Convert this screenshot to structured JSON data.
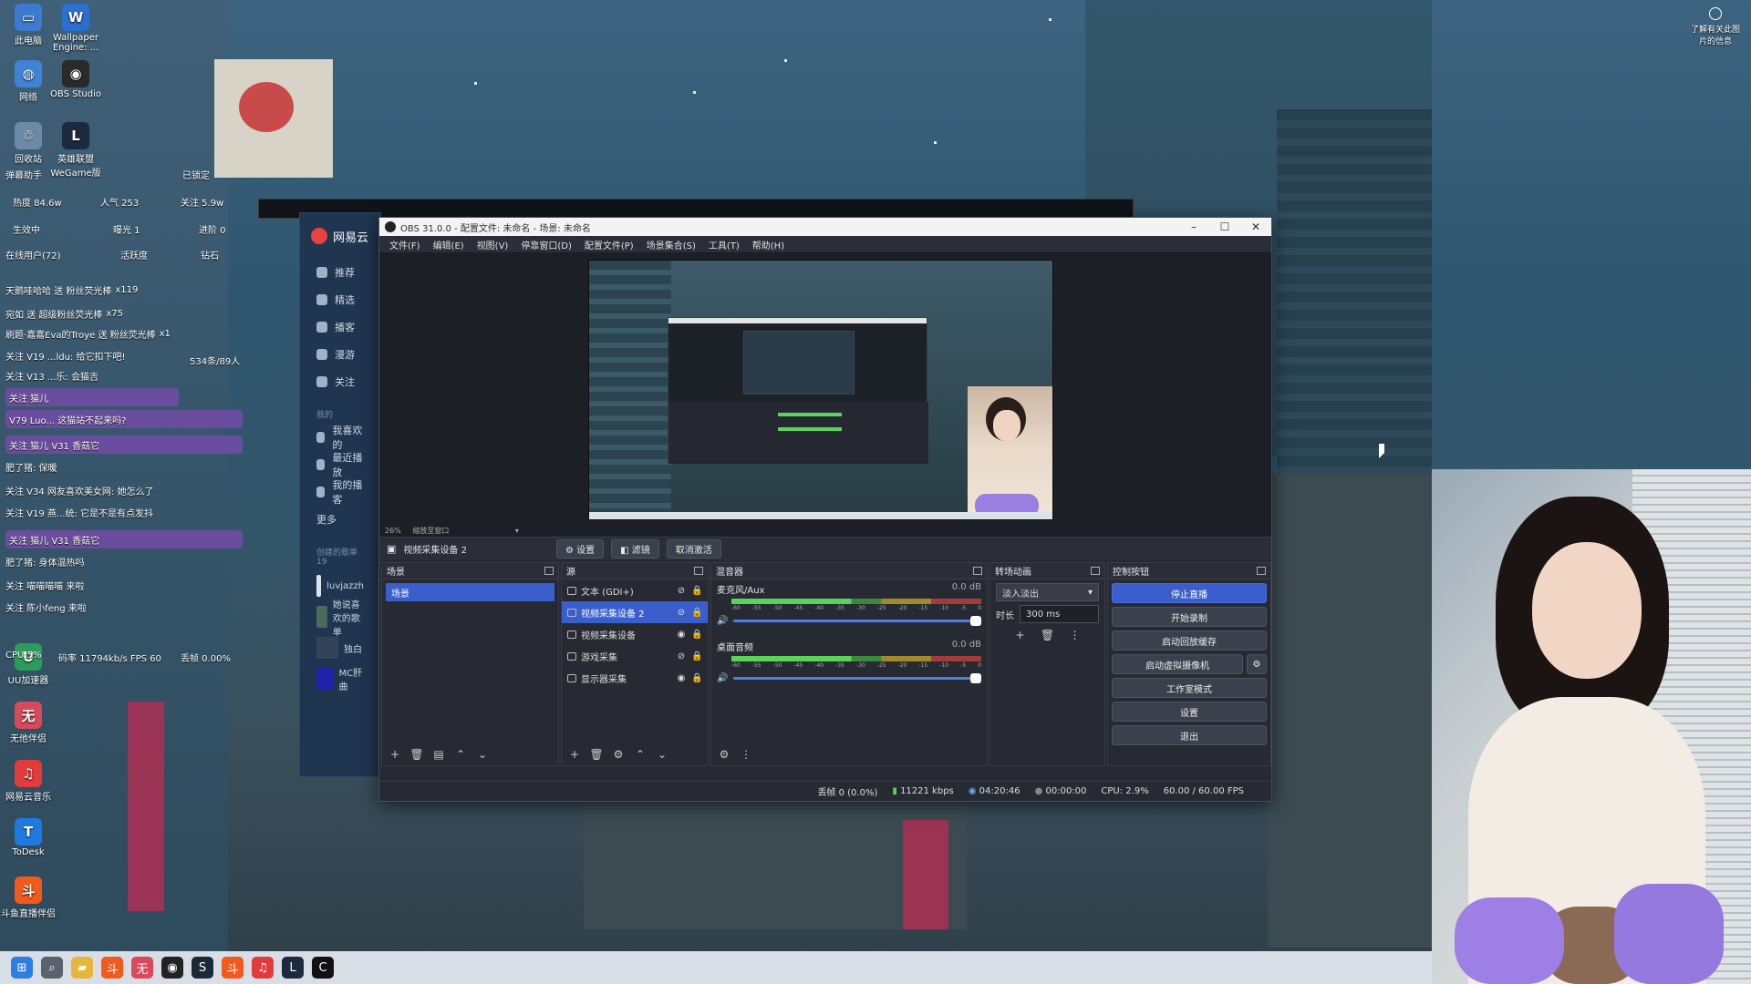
{
  "desktop": {
    "icons": [
      {
        "label": "此电脑",
        "color": "#3d7bd1",
        "glyph": "▭"
      },
      {
        "label": "Wallpaper Engine: ...",
        "color": "#2b6fcf",
        "glyph": "W"
      },
      {
        "label": "网络",
        "color": "#3f83d6",
        "glyph": "◍"
      },
      {
        "label": "OBS Studio",
        "color": "#2a2a2a",
        "glyph": "◉"
      },
      {
        "label": "回收站",
        "color": "#6c8aa8",
        "glyph": "♲"
      },
      {
        "label": "英雄联盟 WeGame版",
        "color": "#1c2a40",
        "glyph": "L"
      },
      {
        "label": "UU加速器",
        "color": "#2a9d5c",
        "glyph": "U"
      },
      {
        "label": "无他伴侣",
        "color": "#d84a5a",
        "glyph": "无"
      },
      {
        "label": "网易云音乐",
        "color": "#e23b3b",
        "glyph": "♫"
      },
      {
        "label": "ToDesk",
        "color": "#1f7ae0",
        "glyph": "T"
      },
      {
        "label": "斗鱼直播伴侣",
        "color": "#f25a1c",
        "glyph": "斗"
      }
    ],
    "hint": "了解有关此图片的信息"
  },
  "chat": {
    "title": "弹幕助手",
    "locked": "已锁定",
    "heat": "热度 84.6w",
    "people": "人气 253",
    "follow": "关注 5.9w",
    "live": "生效中",
    "exposure": "曝光 1",
    "progress": "进阶 0",
    "online": "在线用户(72)",
    "activity": "活跃度",
    "diamond": "钻石",
    "speed_label": "CPU:5%",
    "bitrate": "码率 11794kb/s FPS 60",
    "drop": "丢帧 0.00%",
    "side_count": "534条/89人",
    "lines": [
      {
        "text": "天鹅哇哈哈 送 粉丝荧光棒",
        "count": "x119",
        "hl": false
      },
      {
        "text": "宛如 送 超级粉丝荧光棒",
        "count": "x75",
        "hl": false
      },
      {
        "text": "刷题·嘉嘉Eva的Troye 送 粉丝荧光棒",
        "count": "x1",
        "hl": false
      },
      {
        "text": "关注 V19 ...ldu: 给它扣下吧!",
        "count": "",
        "hl": false
      },
      {
        "text": "关注 V13 ...乐: 会猫吉",
        "count": "",
        "hl": false
      },
      {
        "text": "关注 猫儿",
        "count": "",
        "hl": true
      },
      {
        "text": "V79 Luo... 这猫站不起来吗?",
        "count": "",
        "hl": true
      },
      {
        "text": "关注 猫儿 V31 香菇它",
        "count": "",
        "hl": true
      },
      {
        "text": "肥了猪: 保暖",
        "count": "",
        "hl": false
      },
      {
        "text": "关注 V34 网友喜欢美女网: 她怎么了",
        "count": "",
        "hl": false
      },
      {
        "text": "关注 V19 燕...统: 它是不是有点发抖",
        "count": "",
        "hl": false
      },
      {
        "text": "关注 猫儿 V31 香菇它",
        "count": "",
        "hl": true
      },
      {
        "text": "肥了猪: 身体温热吗",
        "count": "",
        "hl": false
      },
      {
        "text": "关注 喵喵喵喵 来啦",
        "count": "",
        "hl": false
      },
      {
        "text": "关注 陈小feng 来啦",
        "count": "",
        "hl": false
      }
    ]
  },
  "netease": {
    "title": "网易云",
    "nav": [
      "推荐",
      "精选",
      "播客",
      "漫游",
      "关注"
    ],
    "my_section": "我的",
    "my_items": [
      "我喜欢的",
      "最近播放",
      "我的播客"
    ],
    "more": "更多",
    "created": "创建的歌单 19",
    "playlists": [
      {
        "name": "luvjazzh",
        "color": "#dfe3ea"
      },
      {
        "name": "她说喜欢的歌单",
        "color": "#4a6b5a"
      },
      {
        "name": "独白",
        "color": "#34435a"
      },
      {
        "name": "MC肝曲",
        "color": "#2222aa"
      }
    ]
  },
  "obs": {
    "title": "OBS 31.0.0 - 配置文件: 未命名 - 场景: 未命名",
    "menu": [
      "文件(F)",
      "编辑(E)",
      "视图(V)",
      "停靠窗口(D)",
      "配置文件(P)",
      "场景集合(S)",
      "工具(T)",
      "帮助(H)"
    ],
    "zoom": "26%",
    "scale_label": "缩放至窗口",
    "selected_source": "视频采集设备 2",
    "toolbar": {
      "settings": "设置",
      "filters": "滤镜",
      "deactivate": "取消激活"
    },
    "scenes": {
      "title": "场景",
      "items": [
        "场景"
      ]
    },
    "sources": {
      "title": "源",
      "items": [
        {
          "name": "文本 (GDI+)",
          "visible": false,
          "selected": false
        },
        {
          "name": "视频采集设备 2",
          "visible": false,
          "selected": true
        },
        {
          "name": "视频采集设备",
          "visible": true,
          "selected": false
        },
        {
          "name": "游戏采集",
          "visible": false,
          "selected": false
        },
        {
          "name": "显示器采集",
          "visible": true,
          "selected": false
        }
      ]
    },
    "mixer": {
      "title": "混音器",
      "channels": [
        {
          "name": "麦克风/Aux",
          "db": "0.0 dB",
          "volume": 1.0
        },
        {
          "name": "桌面音频",
          "db": "0.0 dB",
          "volume": 1.0
        }
      ],
      "scale": [
        "-60",
        "-55",
        "-50",
        "-45",
        "-40",
        "-35",
        "-30",
        "-25",
        "-20",
        "-15",
        "-10",
        "-5",
        "0"
      ]
    },
    "transitions": {
      "title": "转场动画",
      "type": "淡入淡出",
      "duration_label": "时长",
      "duration": "300 ms"
    },
    "controls": {
      "title": "控制按钮",
      "stop_stream": "停止直播",
      "start_record": "开始录制",
      "replay": "启动回放缓存",
      "virtual_cam": "启动虚拟摄像机",
      "studio": "工作室模式",
      "settings": "设置",
      "exit": "退出"
    },
    "status": {
      "dropped": "丢帧 0 (0.0%)",
      "bitrate": "11221 kbps",
      "stream_time": "04:20:46",
      "rec_time": "00:00:00",
      "cpu": "CPU: 2.9%",
      "fps": "60.00 / 60.00 FPS"
    }
  },
  "taskbar": {
    "apps": [
      {
        "name": "start-icon",
        "glyph": "⊞",
        "color": "#2f7de1"
      },
      {
        "name": "search-icon",
        "glyph": "⌕",
        "color": "#5a6270"
      },
      {
        "name": "folder-icon",
        "glyph": "▰",
        "color": "#e6b63a"
      },
      {
        "name": "douyu-icon",
        "glyph": "斗",
        "color": "#f25a1c"
      },
      {
        "name": "wuta-icon",
        "glyph": "无",
        "color": "#d84a5a"
      },
      {
        "name": "obs-icon",
        "glyph": "◉",
        "color": "#222"
      },
      {
        "name": "steam-icon",
        "glyph": "S",
        "color": "#1b2838"
      },
      {
        "name": "douyu2-icon",
        "glyph": "斗",
        "color": "#f25a1c"
      },
      {
        "name": "netease-icon",
        "glyph": "♫",
        "color": "#e23b3b"
      },
      {
        "name": "lol-icon",
        "glyph": "L",
        "color": "#1c2a40"
      },
      {
        "name": "app-icon",
        "glyph": "C",
        "color": "#111"
      }
    ]
  }
}
